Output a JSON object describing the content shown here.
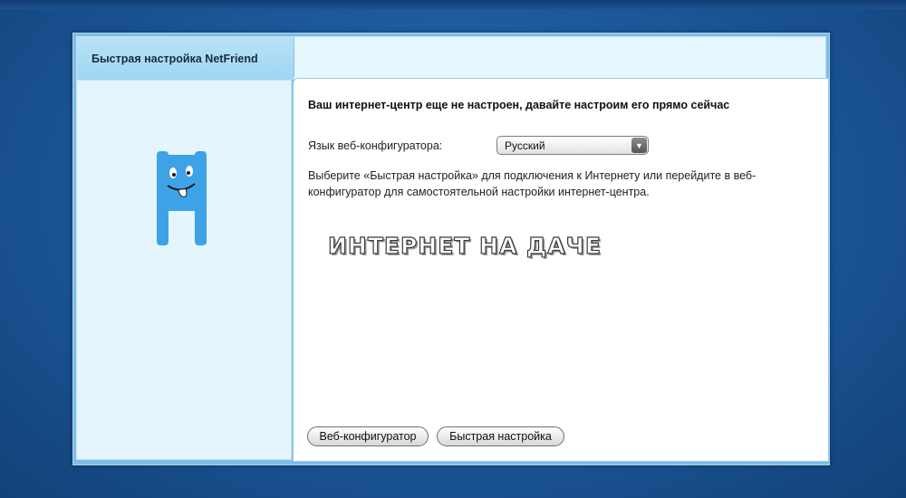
{
  "tabs": {
    "active_label": "Быстрая настройка NetFriend"
  },
  "main": {
    "heading": "Ваш интернет-центр еще не настроен, давайте настроим его прямо сейчас",
    "language_label": "Язык веб-конфигуратора:",
    "language_value": "Русский",
    "description": "Выберите «Быстрая настройка» для подключения к Интернету или перейдите в веб-конфигуратор для самостоятельной настройки интернет-центра.",
    "banner_text": "ИНТЕРНЕТ НА ДАЧЕ"
  },
  "buttons": {
    "web_configurator": "Веб-конфигуратор",
    "quick_setup": "Быстрая настройка"
  },
  "icons": {
    "mascot": "netfriend-mascot-icon",
    "dropdown": "chevron-down-icon"
  },
  "colors": {
    "mascot": "#3ea3e6",
    "panel": "#e4f5fd",
    "window_frame": "#7fbce6"
  }
}
